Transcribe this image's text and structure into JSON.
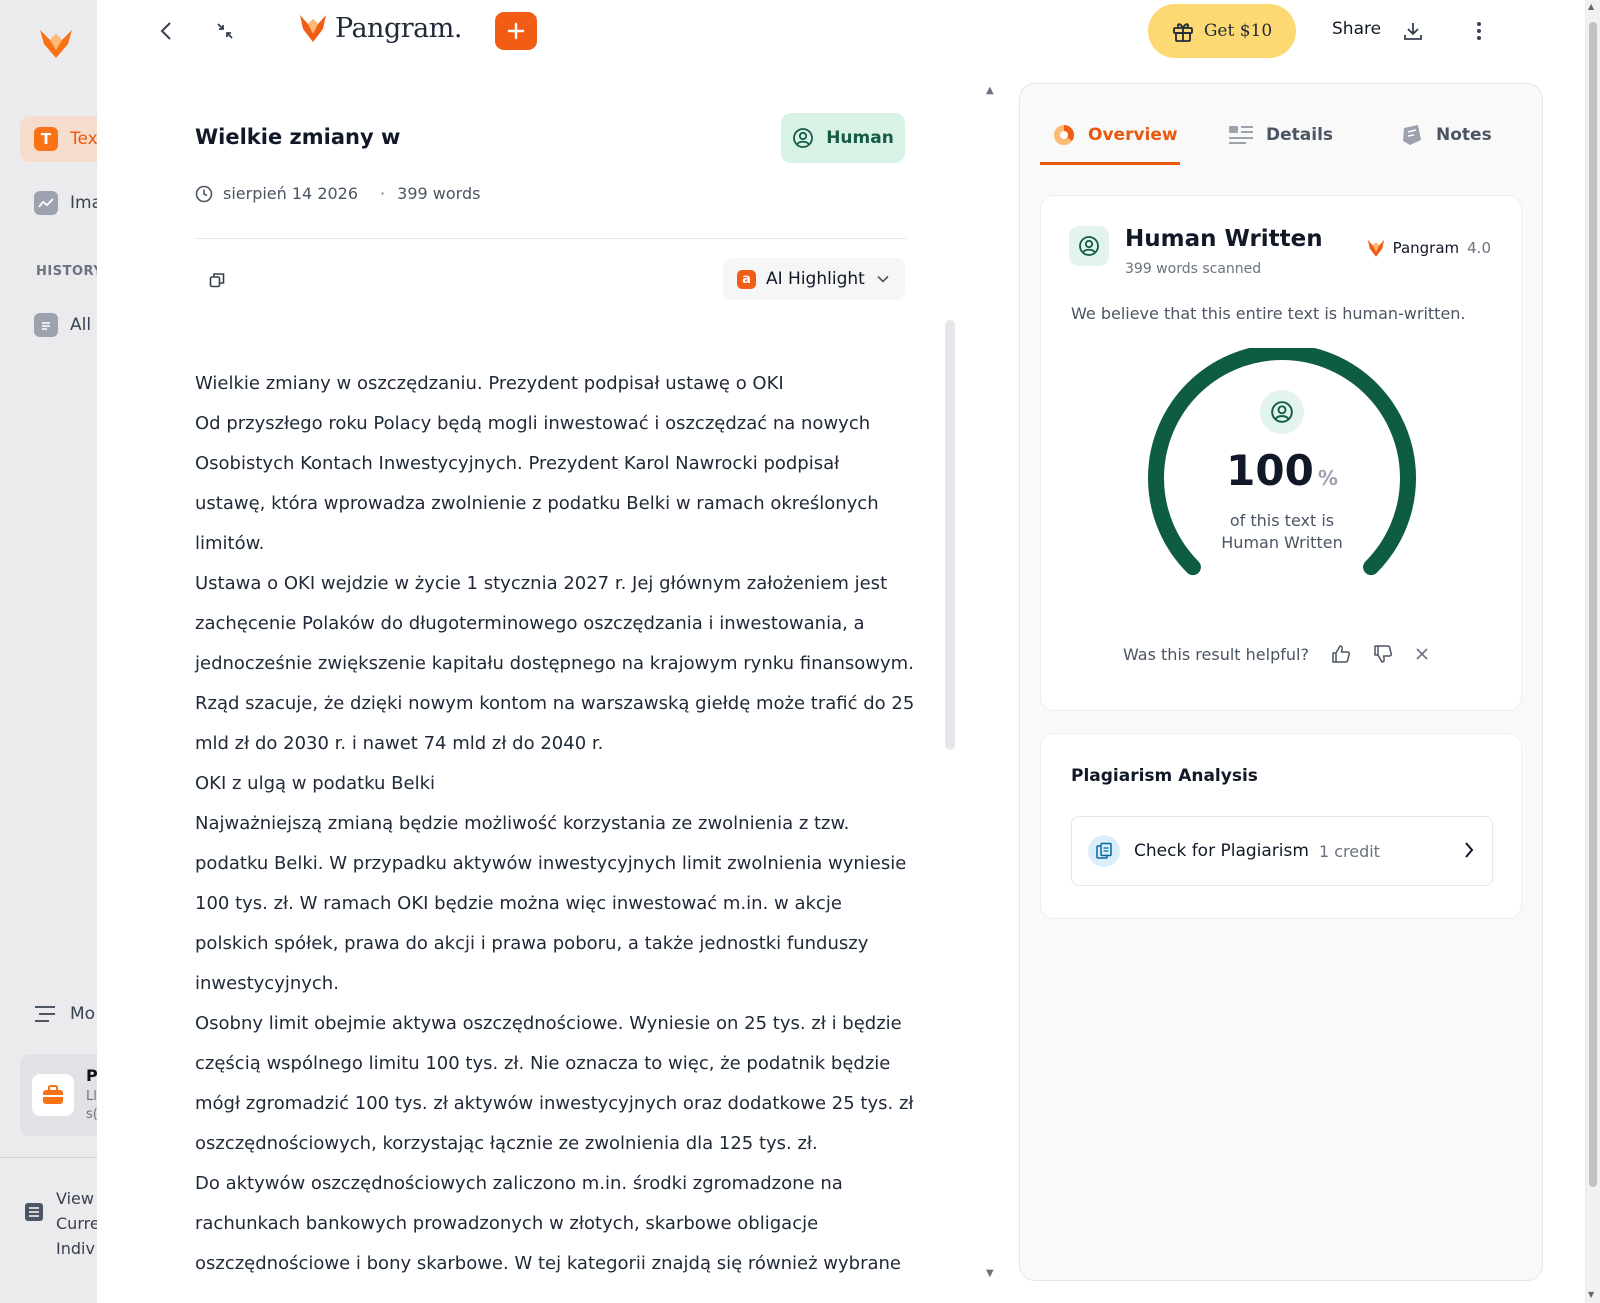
{
  "sidebar": {
    "items": [
      {
        "label": "Tex",
        "icon": "T"
      },
      {
        "label": "Ima"
      }
    ],
    "history_label": "HISTORY",
    "all_label": "All",
    "mo_label": "Mo",
    "card": {
      "title": "P",
      "sub1": "Ll",
      "sub2": "s("
    },
    "view": {
      "line1": "View",
      "line2": "Curre",
      "line3": "Indiv"
    }
  },
  "topbar": {
    "brand": "Pangram.",
    "get_label": "Get $10",
    "share_label": "Share"
  },
  "document": {
    "title": "Wielkie zmiany w",
    "verdict_label": "Human",
    "date": "sierpień 14 2026",
    "separator": "·",
    "words": "399 words",
    "highlight_badge": "a",
    "highlight_label": "AI Highlight",
    "body": "Wielkie zmiany w oszczędzaniu. Prezydent podpisał ustawę o OKI\nOd przyszłego roku Polacy będą mogli inwestować i oszczędzać na nowych Osobistych Kontach Inwestycyjnych. Prezydent Karol Nawrocki podpisał ustawę, która wprowadza zwolnienie z podatku Belki w ramach określonych limitów.\nUstawa o OKI wejdzie w życie 1 stycznia 2027 r. Jej głównym założeniem jest zachęcenie Polaków do długoterminowego oszczędzania i inwestowania, a jednocześnie zwiększenie kapitału dostępnego na krajowym rynku finansowym. Rząd szacuje, że dzięki nowym kontom na warszawską giełdę może trafić do 25 mld zł do 2030 r. i nawet 74 mld zł do 2040 r.\nOKI z ulgą w podatku Belki\nNajważniejszą zmianą będzie możliwość korzystania ze zwolnienia z tzw. podatku Belki. W przypadku aktywów inwestycyjnych limit zwolnienia wyniesie 100 tys. zł. W ramach OKI będzie można więc inwestować m.in. w akcje polskich spółek, prawa do akcji i prawa poboru, a także jednostki funduszy inwestycyjnych.\nOsobny limit obejmie aktywa oszczędnościowe. Wyniesie on 25 tys. zł i będzie częścią wspólnego limitu 100 tys. zł. Nie oznacza to więc, że podatnik będzie mógł zgromadzić 100 tys. zł aktywów inwestycyjnych oraz dodatkowe 25 tys. zł oszczędnościowych, korzystając łącznie ze zwolnienia dla 125 tys. zł.\nDo aktywów oszczędnościowych zaliczono m.in. środki zgromadzone na rachunkach bankowych prowadzonych w złotych, skarbowe obligacje oszczędnościowe i bony skarbowe. W tej kategorii znajdą się również wybrane"
  },
  "panel": {
    "tabs": [
      {
        "label": "Overview",
        "icon": "overview-icon"
      },
      {
        "label": "Details",
        "icon": "details-icon"
      },
      {
        "label": "Notes",
        "icon": "notes-icon"
      }
    ],
    "result": {
      "title": "Human Written",
      "scanned": "399 words scanned",
      "model_name": "Pangram",
      "model_version": "4.0",
      "description": "We believe that this entire text is human-written.",
      "percent": 100,
      "percent_text": "100",
      "percent_unit": "%",
      "label_line1": "of this text is",
      "label_line2": "Human Written",
      "helpful_question": "Was this result helpful?"
    },
    "plagiarism": {
      "title": "Plagiarism Analysis",
      "action_label": "Check for Plagiarism",
      "credit": "1 credit"
    }
  },
  "colors": {
    "brand_orange": "#f25d16",
    "human_green": "#0f5c45",
    "human_bg": "#d9f2e6"
  }
}
